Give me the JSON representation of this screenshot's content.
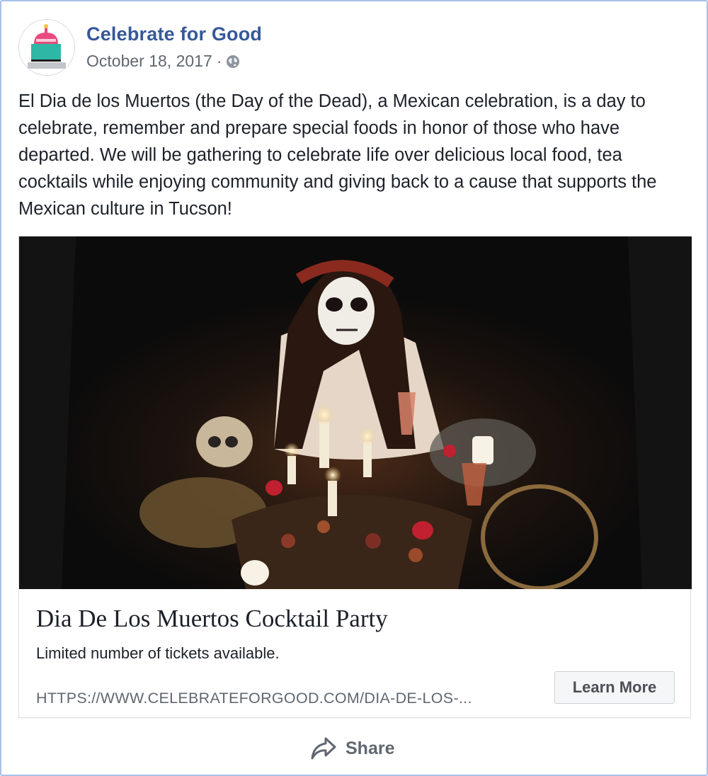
{
  "post": {
    "page_name": "Celebrate for Good",
    "date": "October 18, 2017",
    "separator": "·",
    "privacy_icon": "globe-icon",
    "text": "El Dia de los Muertos (the Day of the Dead), a Mexican celebration, is a day to celebrate, remember and prepare special foods in honor of those who have departed. We will be gathering to celebrate life over delicious local food, tea cocktails while enjoying community and giving back to a cause that supports the Mexican culture in Tucson!"
  },
  "link_card": {
    "title": "Dia De Los Muertos Cocktail Party",
    "description": "Limited number of tickets available.",
    "url": "HTTPS://WWW.CELEBRATEFORGOOD.COM/DIA-DE-LOS-...",
    "cta_label": "Learn More"
  },
  "actions": {
    "share_label": "Share",
    "share_icon": "share-arrow-icon"
  },
  "colors": {
    "link": "#365899",
    "meta_text": "#606770",
    "body_text": "#1d2129",
    "frame_border": "#a9c1e8"
  }
}
